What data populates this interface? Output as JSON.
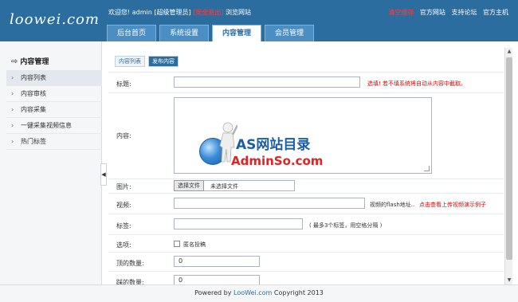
{
  "header": {
    "logo": "loowei.com",
    "welcome_prefix": "欢迎您! admin [超级管理员]",
    "logout": "[安全退出]",
    "browse": "浏览网站",
    "links": [
      "清空缓存",
      "官方网站",
      "支持论坛",
      "官方主机"
    ],
    "tabs": [
      {
        "label": "后台首页",
        "active": false
      },
      {
        "label": "系统设置",
        "active": false
      },
      {
        "label": "内容管理",
        "active": true
      },
      {
        "label": "会员管理",
        "active": false
      }
    ]
  },
  "sidebar": {
    "title": "内容管理",
    "items": [
      {
        "label": "内容列表",
        "active": true
      },
      {
        "label": "内容审核",
        "active": false
      },
      {
        "label": "内容采集",
        "active": false
      },
      {
        "label": "一键采集视频信息",
        "active": false
      },
      {
        "label": "热门标签",
        "active": false
      }
    ],
    "collapse_glyph": "◀"
  },
  "content": {
    "subtabs": [
      {
        "label": "内容列表",
        "active": false
      },
      {
        "label": "发布内容",
        "active": true
      }
    ],
    "form": {
      "title_label": "标题:",
      "title_value": "",
      "title_hint": "选填! 若不填系统将自动从内容中截取。",
      "content_label": "内容:",
      "content_value": "",
      "image_label": "图片:",
      "file_button": "选择文件",
      "file_status": "未选择文件",
      "video_label": "视频:",
      "video_value": "",
      "video_hint_prefix": "视频的flash地址..",
      "video_hint_link": "点击查看上传视频演示例子",
      "tags_label": "标签:",
      "tags_value": "",
      "tags_hint": "( 最多3个标签，用空格分隔 )",
      "option_label": "选项:",
      "anonymous_label": "匿名投稿",
      "anonymous_checked": false,
      "up_label": "顶的数量:",
      "up_value": "0",
      "down_label": "踩的数量:",
      "down_value": "0"
    }
  },
  "watermark": {
    "line1": "AS网站目录",
    "line2": "AdminSo.com"
  },
  "footer": {
    "prefix": "Powered by",
    "link": "LooWei.com",
    "suffix": "Copyright 2013"
  },
  "colors": {
    "header_bg": "#2c6da0",
    "accent_red": "#e00000"
  }
}
